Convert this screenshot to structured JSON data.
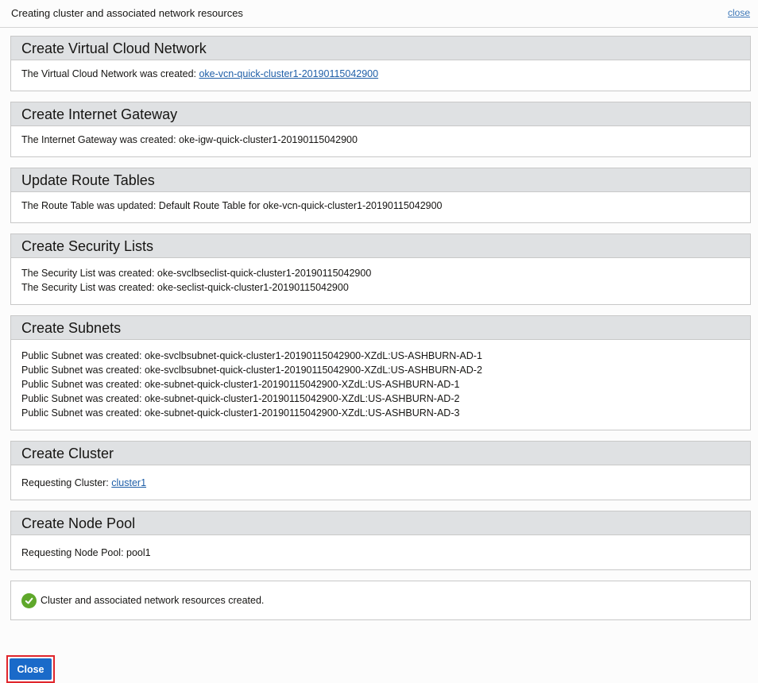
{
  "header": {
    "title": "Creating cluster and associated network resources",
    "close_link": "close"
  },
  "sections": {
    "vcn": {
      "title": "Create Virtual Cloud Network",
      "prefix": "The Virtual Cloud Network was created: ",
      "link": "oke-vcn-quick-cluster1-20190115042900"
    },
    "igw": {
      "title": "Create Internet Gateway",
      "line": "The Internet Gateway was created: oke-igw-quick-cluster1-20190115042900"
    },
    "route": {
      "title": "Update Route Tables",
      "line": "The Route Table was updated: Default Route Table for oke-vcn-quick-cluster1-20190115042900"
    },
    "seclists": {
      "title": "Create Security Lists",
      "lines": [
        "The Security List was created: oke-svclbseclist-quick-cluster1-20190115042900",
        "The Security List was created: oke-seclist-quick-cluster1-20190115042900"
      ]
    },
    "subnets": {
      "title": "Create Subnets",
      "lines": [
        "Public Subnet was created: oke-svclbsubnet-quick-cluster1-20190115042900-XZdL:US-ASHBURN-AD-1",
        "Public Subnet was created: oke-svclbsubnet-quick-cluster1-20190115042900-XZdL:US-ASHBURN-AD-2",
        "Public Subnet was created: oke-subnet-quick-cluster1-20190115042900-XZdL:US-ASHBURN-AD-1",
        "Public Subnet was created: oke-subnet-quick-cluster1-20190115042900-XZdL:US-ASHBURN-AD-2",
        "Public Subnet was created: oke-subnet-quick-cluster1-20190115042900-XZdL:US-ASHBURN-AD-3"
      ]
    },
    "cluster": {
      "title": "Create Cluster",
      "prefix": "Requesting Cluster: ",
      "link": "cluster1"
    },
    "nodepool": {
      "title": "Create Node Pool",
      "line": "Requesting Node Pool: pool1"
    }
  },
  "status": {
    "icon": "check-circle-icon",
    "message": "Cluster and associated network resources created.",
    "color": "#5fa82b"
  },
  "footer": {
    "close_button": "Close"
  }
}
